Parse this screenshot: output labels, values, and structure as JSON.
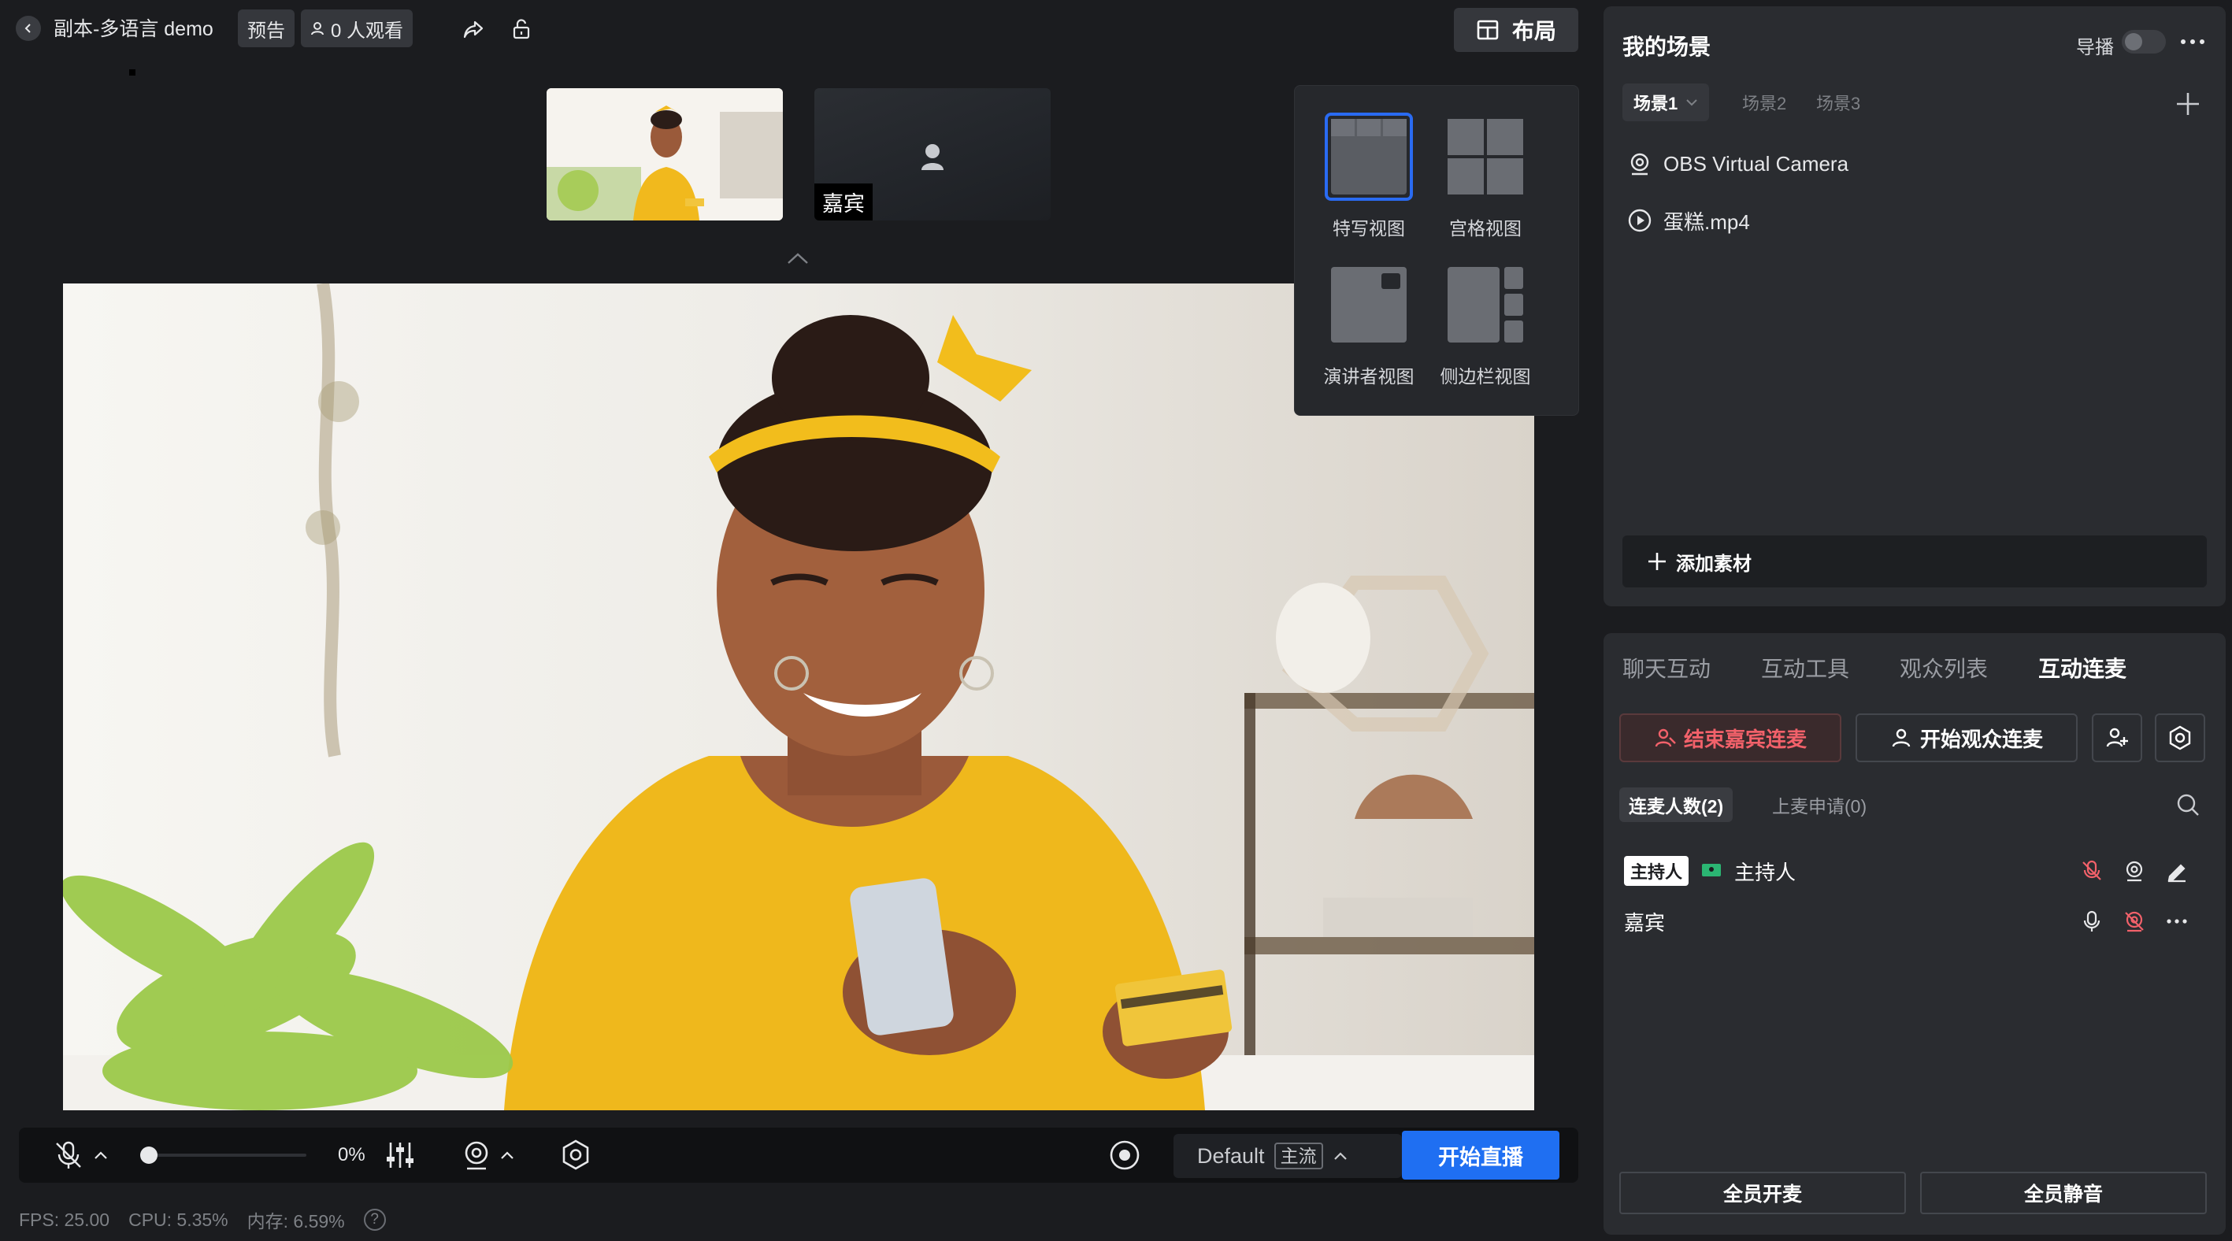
{
  "header": {
    "title": "副本-多语言 demo",
    "badge_preview": "预告",
    "viewers": "0 人观看",
    "layout_button": "布局"
  },
  "thumbnails": {
    "guest_label": "嘉宾"
  },
  "layout_menu": {
    "options": [
      {
        "label": "特写视图",
        "selected": true
      },
      {
        "label": "宫格视图",
        "selected": false
      },
      {
        "label": "演讲者视图",
        "selected": false
      },
      {
        "label": "侧边栏视图",
        "selected": false
      }
    ]
  },
  "toolbar": {
    "volume_level": 0,
    "volume_text": "0%",
    "stream_name": "Default",
    "stream_tag": "主流",
    "go_live": "开始直播"
  },
  "stats": {
    "fps": "FPS: 25.00",
    "cpu": "CPU: 5.35%",
    "memory": "内存: 6.59%",
    "help": "?"
  },
  "scene_panel": {
    "title": "我的场景",
    "director_label": "导播",
    "director_on": false,
    "scenes": [
      "场景1",
      "场景2",
      "场景3"
    ],
    "active_scene": "场景1",
    "sources": [
      {
        "icon": "camera-icon",
        "label": "OBS Virtual Camera"
      },
      {
        "icon": "play-icon",
        "label": "蛋糕.mp4"
      }
    ],
    "add_source": "添加素材"
  },
  "interaction_panel": {
    "tabs": [
      "聊天互动",
      "互动工具",
      "观众列表",
      "互动连麦"
    ],
    "active_tab": "互动连麦",
    "end_guest": "结束嘉宾连麦",
    "start_audience": "开始观众连麦",
    "sub_tabs": [
      "连麦人数(2)",
      "上麦申请(0)"
    ],
    "members": [
      {
        "badge": "主持人",
        "name": "主持人"
      },
      {
        "name": "嘉宾"
      }
    ],
    "mute_all_mic": "全员开麦",
    "mute_all": "全员静音"
  },
  "colors": {
    "accent": "#1f6ff2",
    "danger": "#f2616a",
    "background": "#1b1c1f",
    "panel": "#2a2c30"
  }
}
